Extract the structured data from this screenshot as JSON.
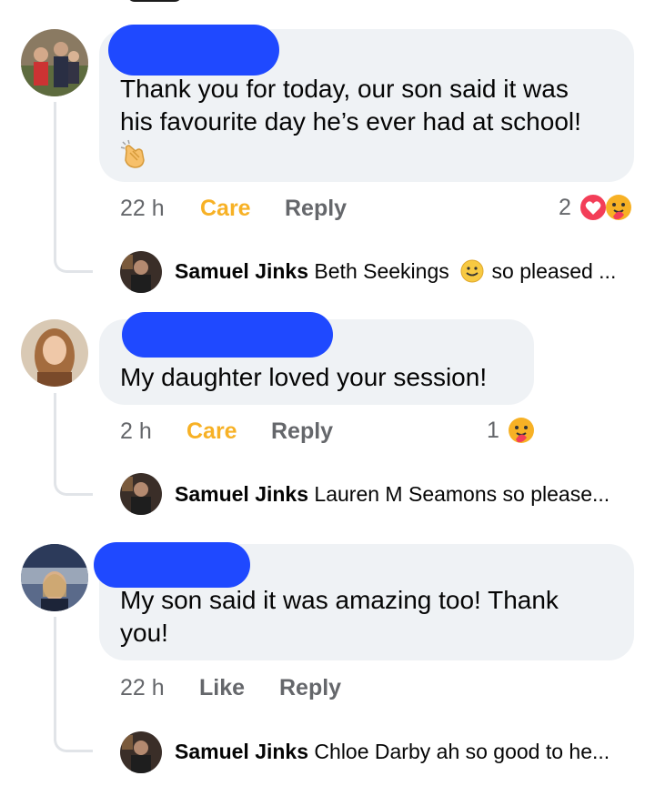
{
  "comments": [
    {
      "text": "Thank you for today, our son said it was his favourite day he’s ever had at school!",
      "line1": "Thank you for today, our son said it was",
      "line2": "his favourite day he’s ever had at school!",
      "emoji_icon": "clapping-hands-icon",
      "time": "22 h",
      "reaction_label": "Care",
      "reply_label": "Reply",
      "reaction_count": "2",
      "reaction_icons": [
        "love-heart-icon",
        "care-hug-icon"
      ],
      "reply": {
        "name": "Samuel Jinks",
        "text_before": "Beth Seekings",
        "text_after": "so pleased ...",
        "emoji_icon": "smiling-face-icon"
      }
    },
    {
      "text": "My daughter loved your session!",
      "time": "2 h",
      "reaction_label": "Care",
      "reply_label": "Reply",
      "reaction_count": "1",
      "reaction_icons": [
        "care-hug-icon"
      ],
      "reply": {
        "name": "Samuel Jinks",
        "text": "Lauren M Seamons so please..."
      }
    },
    {
      "line1": "My son said it was amazing too! Thank",
      "line2": "you!",
      "time": "22 h",
      "reaction_label": "Like",
      "reply_label": "Reply",
      "reply": {
        "name": "Samuel Jinks",
        "text": "Chloe Darby ah so good to he..."
      }
    }
  ],
  "colors": {
    "bubble": "#eff2f5",
    "redaction": "#1f49ff",
    "care": "#f7b125",
    "meta": "#65676b"
  }
}
